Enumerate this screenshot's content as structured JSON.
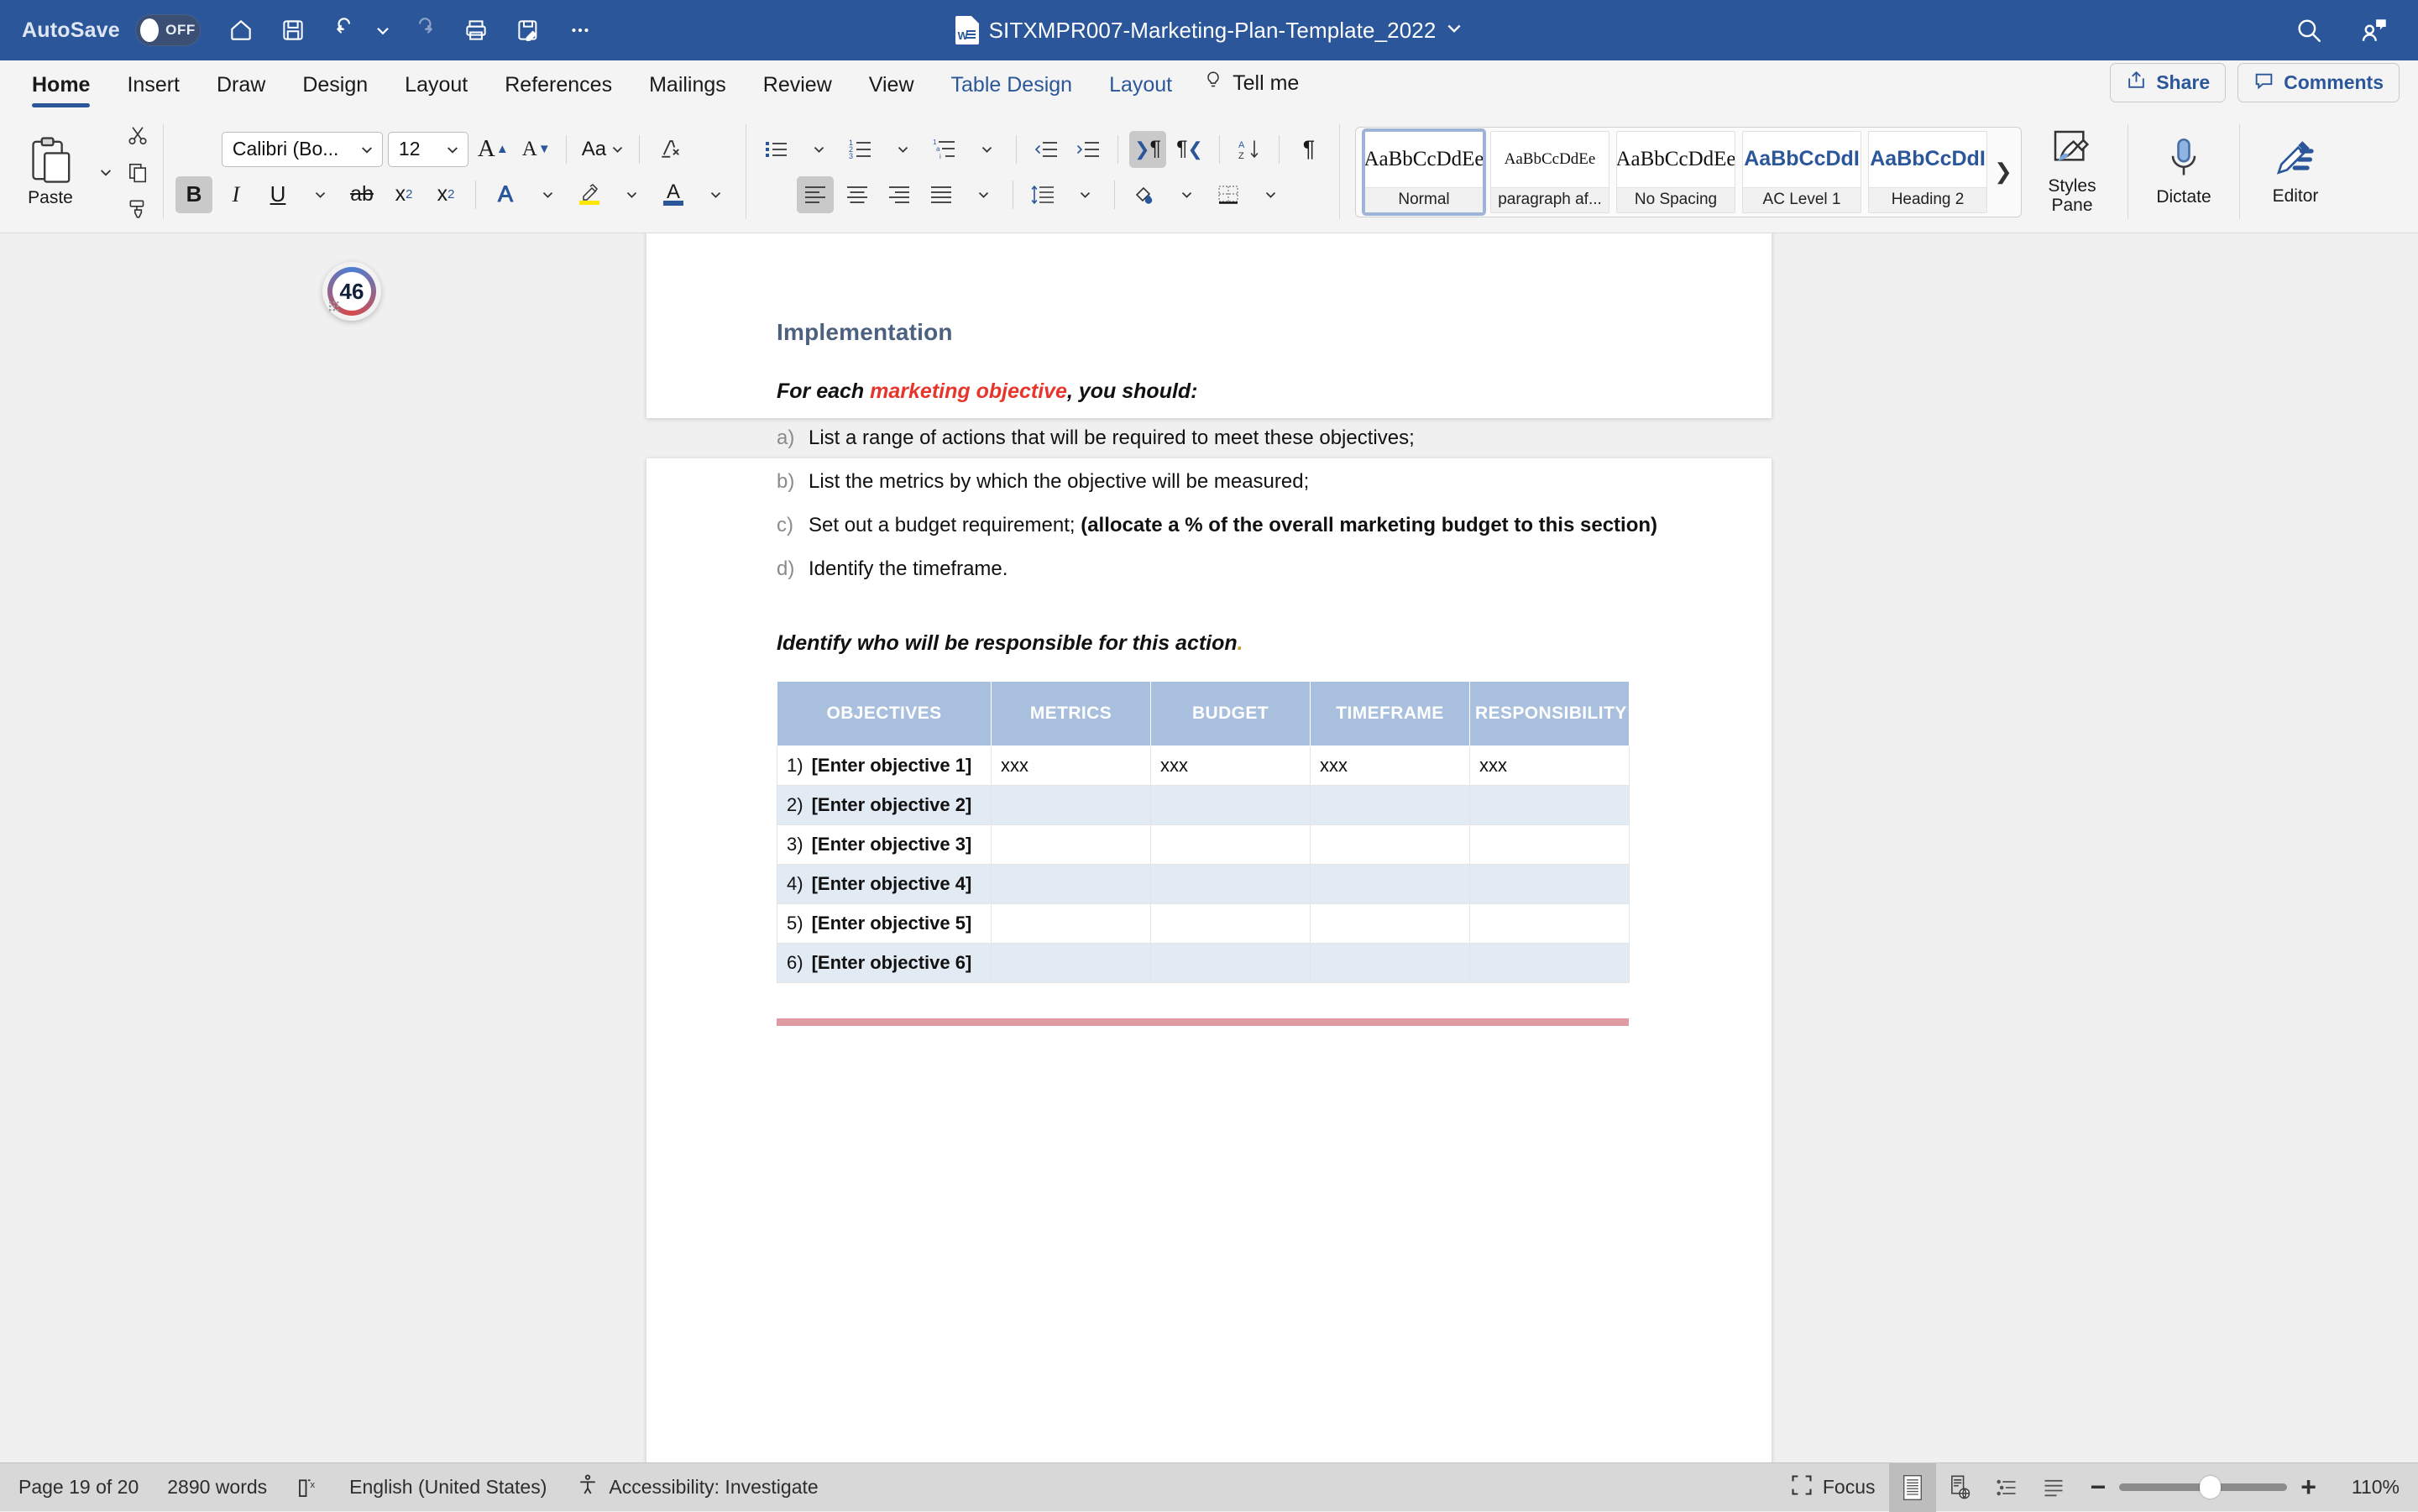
{
  "titlebar": {
    "autosave_label": "AutoSave",
    "autosave_state": "OFF",
    "document_title": "SITXMPR007-Marketing-Plan-Template_2022",
    "quick_access": [
      "home-icon",
      "save-icon",
      "undo-icon",
      "undo-dropdown-icon",
      "redo-icon",
      "print-icon",
      "save-as-icon",
      "more-commands-icon"
    ],
    "right_icons": [
      "search-icon",
      "collaborators-icon"
    ],
    "bg_color": "#2b579a"
  },
  "ribbon_tabs": {
    "items": [
      {
        "label": "Home",
        "active": true,
        "accent": false
      },
      {
        "label": "Insert",
        "active": false,
        "accent": false
      },
      {
        "label": "Draw",
        "active": false,
        "accent": false
      },
      {
        "label": "Design",
        "active": false,
        "accent": false
      },
      {
        "label": "Layout",
        "active": false,
        "accent": false
      },
      {
        "label": "References",
        "active": false,
        "accent": false
      },
      {
        "label": "Mailings",
        "active": false,
        "accent": false
      },
      {
        "label": "Review",
        "active": false,
        "accent": false
      },
      {
        "label": "View",
        "active": false,
        "accent": false
      },
      {
        "label": "Table Design",
        "active": false,
        "accent": true
      },
      {
        "label": "Layout",
        "active": false,
        "accent": true
      }
    ],
    "tell_me": "Tell me",
    "share": "Share",
    "comments": "Comments",
    "accent_color": "#2b579a"
  },
  "ribbon": {
    "paste_label": "Paste",
    "font_name": "Calibri (Bo...",
    "font_size": "12",
    "bold_active": true,
    "align_left_active": true,
    "ltr_active": true,
    "styles": [
      {
        "preview": "AaBbCcDdEе",
        "name": "Normal",
        "selected": true,
        "variant": "serif"
      },
      {
        "preview": "AaBbCcDdEe",
        "name": "paragraph af...",
        "selected": false,
        "variant": "serif-small"
      },
      {
        "preview": "AaBbCcDdEе",
        "name": "No Spacing",
        "selected": false,
        "variant": "serif"
      },
      {
        "preview": "AaBbCcDdI",
        "name": "AC Level 1",
        "selected": false,
        "variant": "blue"
      },
      {
        "preview": "AaBbCcDdI",
        "name": "Heading 2",
        "selected": false,
        "variant": "blue"
      }
    ],
    "styles_pane_label": "Styles\nPane",
    "styles_pane_line1": "Styles",
    "styles_pane_line2": "Pane",
    "dictate_label": "Dictate",
    "editor_label": "Editor"
  },
  "comment_badge": {
    "count": "46"
  },
  "document": {
    "heading": "Implementation",
    "intro_prefix": "For each ",
    "intro_highlight": "marketing objective",
    "intro_suffix": ", you should:",
    "list": [
      {
        "marker": "a)",
        "text": "List a range of actions that will be required to meet these objectives;",
        "bold_tail": ""
      },
      {
        "marker": "b)",
        "text": "List the metrics by which the objective will be measured;",
        "bold_tail": ""
      },
      {
        "marker": "c)",
        "text": "Set out a budget requirement; ",
        "bold_tail": "(allocate a % of the overall marketing budget to this section)"
      },
      {
        "marker": "d)",
        "text": "Identify the timeframe.",
        "bold_tail": ""
      }
    ],
    "responsibility_line": "Identify who will be responsible for this action",
    "responsibility_dot": ".",
    "table": {
      "headers": [
        "OBJECTIVES",
        "METRICS",
        "BUDGET",
        "TIMEFRAME",
        "RESPONSIBILITY"
      ],
      "header_bg": "#a8c0de",
      "rows": [
        {
          "n": "1)",
          "objective": "[Enter objective 1]",
          "metrics": "xxx",
          "budget": "xxx",
          "timeframe": "xxx",
          "responsibility": "xxx"
        },
        {
          "n": "2)",
          "objective": "[Enter objective 2]",
          "metrics": "",
          "budget": "",
          "timeframe": "",
          "responsibility": ""
        },
        {
          "n": "3)",
          "objective": "[Enter objective 3]",
          "metrics": "",
          "budget": "",
          "timeframe": "",
          "responsibility": ""
        },
        {
          "n": "4)",
          "objective": "[Enter objective 4]",
          "metrics": "",
          "budget": "",
          "timeframe": "",
          "responsibility": ""
        },
        {
          "n": "5)",
          "objective": "[Enter objective 5]",
          "metrics": "",
          "budget": "",
          "timeframe": "",
          "responsibility": ""
        },
        {
          "n": "6)",
          "objective": "[Enter objective 6]",
          "metrics": "",
          "budget": "",
          "timeframe": "",
          "responsibility": ""
        }
      ]
    },
    "divider_color": "#e09aa3"
  },
  "statusbar": {
    "page_info": "Page 19 of 20",
    "word_count": "2890 words",
    "language": "English (United States)",
    "accessibility": "Accessibility: Investigate",
    "focus_label": "Focus",
    "zoom_level": "110%",
    "zoom_minus": "−",
    "zoom_plus": "+"
  }
}
